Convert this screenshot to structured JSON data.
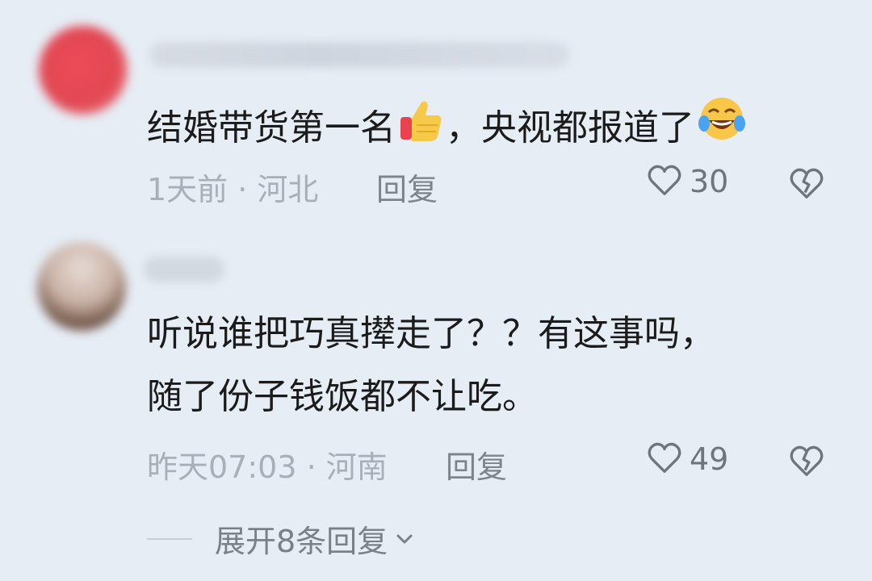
{
  "comments": [
    {
      "text_before": "结婚带货第一名",
      "emoji_1": "thumbs-up-icon",
      "text_after": "，央视都报道了",
      "emoji_2": "laughing-crying-icon",
      "meta": "1天前 · 河北",
      "reply_label": "回复",
      "likes": "30"
    },
    {
      "line_1": "听说谁把巧真撵走了？？有这事吗，",
      "line_2": "随了份子钱饭都不让吃。",
      "meta": "昨天07:03 · 河南",
      "reply_label": "回复",
      "likes": "49"
    }
  ],
  "expand": {
    "label": "展开8条回复"
  },
  "colors": {
    "background": "#e6edf5",
    "text": "#1b1b1b",
    "meta": "#a9aeb8",
    "icon": "#6f747d"
  }
}
